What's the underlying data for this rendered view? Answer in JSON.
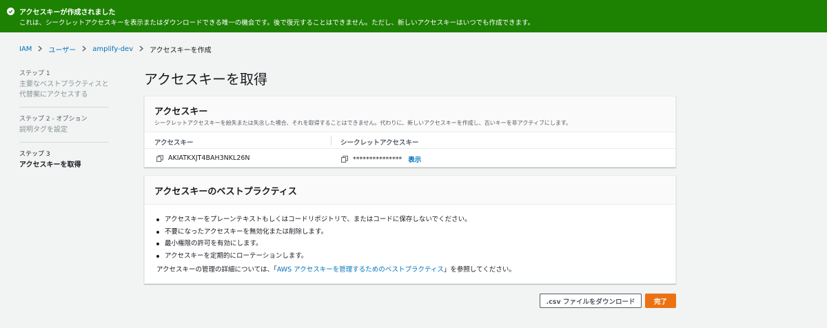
{
  "banner": {
    "title": "アクセスキーが作成されました",
    "message": "これは、シークレットアクセスキーを表示またはダウンロードできる唯一の機会です。後で復元することはできません。ただし、新しいアクセスキーはいつでも作成できます。",
    "color": "#1d8102"
  },
  "breadcrumb": {
    "items": [
      "IAM",
      "ユーザー",
      "amplify-dev"
    ],
    "current": "アクセスキーを作成"
  },
  "steps": [
    {
      "label": "ステップ 1",
      "text": "主要なベストプラクティスと代替案にアクセスする"
    },
    {
      "label": "ステップ 2 - オプション",
      "text": "説明タグを設定"
    },
    {
      "label": "ステップ 3",
      "text": "アクセスキーを取得"
    }
  ],
  "page_title": "アクセスキーを取得",
  "access_key_card": {
    "title": "アクセスキー",
    "description": "シークレットアクセスキーを紛失または失念した場合、それを取得することはできません。代わりに、新しいアクセスキーを作成し、古いキーを非アクティブにします。",
    "col_access_key": "アクセスキー",
    "col_secret_key": "シークレットアクセスキー",
    "access_key_value": "AKIATKXJT4BAH3NKL26N",
    "secret_key_masked": "***************",
    "show_label": "表示"
  },
  "best_practices_card": {
    "title": "アクセスキーのベストプラクティス",
    "items": [
      "アクセスキーをプレーンテキストもしくはコードリポジトリで、またはコードに保存しないでください。",
      "不要になったアクセスキーを無効化または削除します。",
      "最小権限の許可を有効にします。",
      "アクセスキーを定期的にローテーションします。"
    ],
    "note_prefix": "アクセスキーの管理の詳細については、「",
    "note_link": "AWS アクセスキーを管理するためのベストプラクティス",
    "note_suffix": "」を参照してください。"
  },
  "buttons": {
    "download_csv": ".csv ファイルをダウンロード",
    "done": "完了"
  },
  "colors": {
    "accent": "#ec7211",
    "link": "#0073bb"
  }
}
